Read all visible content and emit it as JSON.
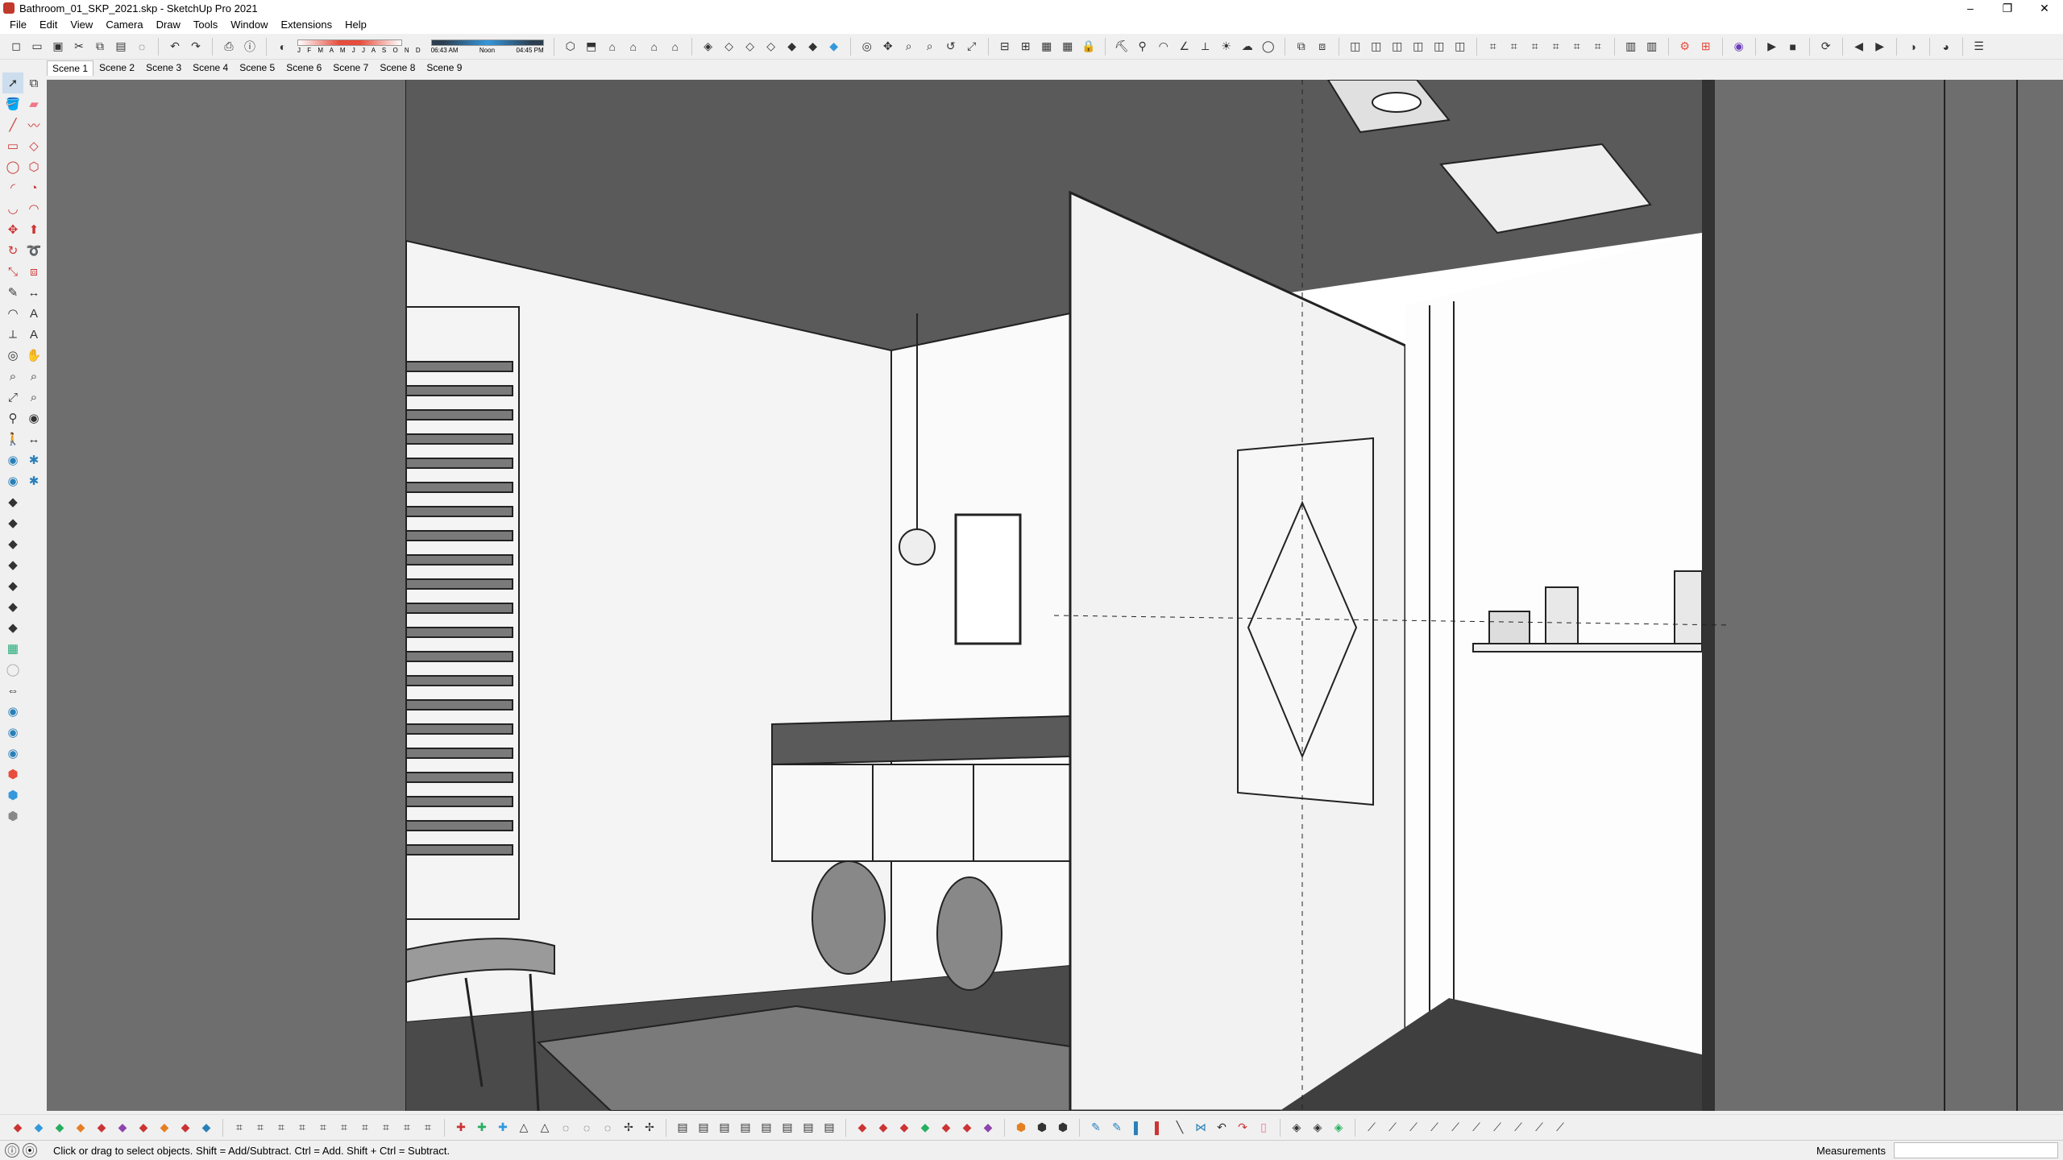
{
  "window": {
    "title": "Bathroom_01_SKP_2021.skp - SketchUp Pro 2021",
    "minimize": "–",
    "maximize": "❐",
    "close": "✕"
  },
  "menu": [
    "File",
    "Edit",
    "View",
    "Camera",
    "Draw",
    "Tools",
    "Window",
    "Extensions",
    "Help"
  ],
  "shadow_settings": {
    "months": "J F M A M J J A S O N D",
    "time_start": "06:43 AM",
    "time_mid": "Noon",
    "time_end": "04:45 PM"
  },
  "scenes": {
    "tabs": [
      "Scene 1",
      "Scene 2",
      "Scene 3",
      "Scene 4",
      "Scene 5",
      "Scene 6",
      "Scene 7",
      "Scene 8",
      "Scene 9"
    ],
    "active": "Scene 1"
  },
  "toolbars": {
    "top_icons": [
      "new-icon",
      "open-icon",
      "save-icon",
      "cut-icon",
      "copy-icon",
      "paste-icon",
      "erase-icon",
      "undo-icon",
      "redo-icon",
      "print-icon",
      "model-info-icon",
      "shadows-icon",
      "iso-view-icon",
      "top-view-icon",
      "front-view-icon",
      "right-view-icon",
      "back-view-icon",
      "left-view-icon",
      "xray-icon",
      "back-edges-icon",
      "wireframe-icon",
      "hidden-line-icon",
      "shaded-icon",
      "textured-icon",
      "monochrome-icon",
      "section-plane-icon",
      "orbit-icon",
      "pan-icon",
      "zoom-icon",
      "styles-icon",
      "components-icon",
      "outliner-icon"
    ],
    "left_icons": [
      "select-icon",
      "component-icon",
      "paint-bucket-icon",
      "eraser-icon",
      "line-icon",
      "freehand-icon",
      "rectangle-icon",
      "rotated-rectangle-icon",
      "circle-icon",
      "polygon-icon",
      "arc-icon",
      "pie-icon",
      "two-point-arc-icon",
      "three-point-arc-icon",
      "move-icon",
      "push-pull-icon",
      "rotate-icon",
      "follow-me-icon",
      "scale-icon",
      "offset-icon",
      "tape-measure-icon",
      "dimension-icon",
      "protractor-icon",
      "text-icon",
      "axes-icon",
      "3d-text-icon",
      "orbit-icon",
      "pan-icon",
      "zoom-icon",
      "zoom-window-icon",
      "zoom-extents-icon",
      "previous-view-icon",
      "position-camera-icon",
      "look-around-icon",
      "walk-icon",
      "section-plane-icon",
      "add-location-icon",
      "photo-textures-icon"
    ],
    "bottom_icons_count": 70
  },
  "status": {
    "hint": "Click or drag to select objects. Shift = Add/Subtract. Ctrl = Add. Shift + Ctrl = Subtract.",
    "measurements_label": "Measurements",
    "measurements_value": ""
  },
  "colors": {
    "ceiling": "#5a5a5a",
    "floor": "#4a4a4a",
    "walls": "#f4f4f4",
    "dark_panels": "#6e6e6e",
    "accent_red": "#e74c3c"
  }
}
